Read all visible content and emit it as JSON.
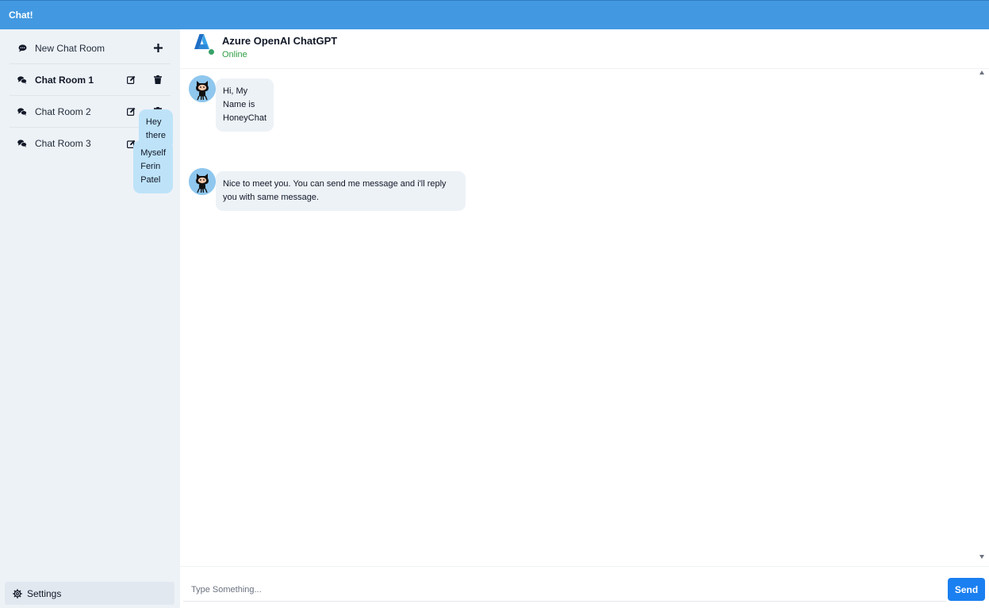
{
  "app": {
    "brand": "Chat!"
  },
  "sidebar": {
    "new_room": {
      "label": "New Chat Room",
      "icon": "chat-bubble-icon",
      "action_icon": "plus-icon"
    },
    "rooms": [
      {
        "label": "Chat Room 1",
        "active": true
      },
      {
        "label": "Chat Room 2",
        "active": false
      },
      {
        "label": "Chat Room 3",
        "active": false
      }
    ],
    "settings": {
      "label": "Settings",
      "icon": "gear-icon"
    }
  },
  "chat": {
    "title": "Azure OpenAI ChatGPT",
    "status": "Online",
    "messages": [
      {
        "from": "bot",
        "text": "Hi, My Name is HoneyChat"
      },
      {
        "from": "user",
        "text": "Hey there"
      },
      {
        "from": "user",
        "text": "Myself Ferin Patel"
      },
      {
        "from": "bot",
        "text": "Nice to meet you. You can send me message and i'll reply you with same message."
      }
    ]
  },
  "composer": {
    "placeholder": "Type Something...",
    "value": "",
    "send_label": "Send"
  },
  "colors": {
    "header": "#4299e1",
    "sidebar_bg": "#edf2f7",
    "bot_bubble": "#edf2f7",
    "user_bubble": "#bee3f8",
    "send": "#1a7ff0",
    "online": "#2f9e44"
  }
}
